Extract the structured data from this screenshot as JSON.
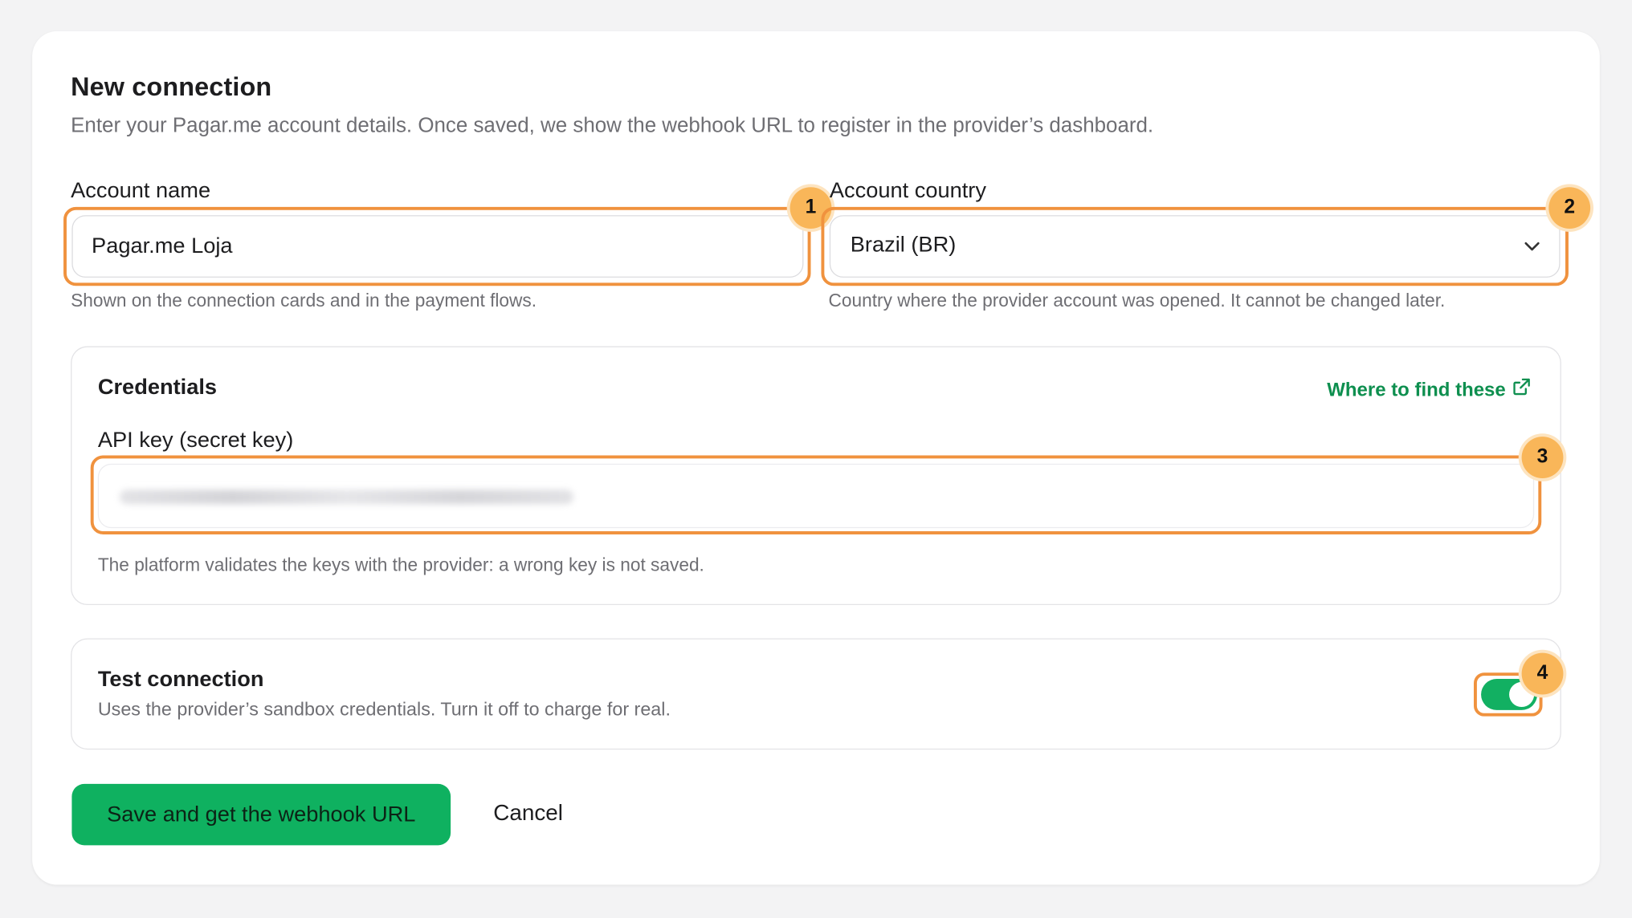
{
  "form": {
    "title": "New connection",
    "subtitle": "Enter your Pagar.me account details. Once saved, we show the webhook URL to register in the provider’s dashboard."
  },
  "account_name": {
    "label": "Account name",
    "value": "Pagar.me Loja",
    "help": "Shown on the connection cards and in the payment flows."
  },
  "account_country": {
    "label": "Account country",
    "selected": "Brazil (BR)",
    "help": "Country where the provider account was opened. It cannot be changed later."
  },
  "credentials": {
    "title": "Credentials",
    "link_label": "Where to find these",
    "api_key_label": "API key (secret key)",
    "api_key_value_redacted": true,
    "help": "The platform validates the keys with the provider: a wrong key is not saved."
  },
  "test_connection": {
    "title": "Test connection",
    "description": "Uses the provider’s sandbox credentials. Turn it off to charge for real.",
    "enabled": true
  },
  "actions": {
    "save_label": "Save and get the webhook URL",
    "cancel_label": "Cancel"
  },
  "callouts": [
    "1",
    "2",
    "3",
    "4"
  ],
  "colors": {
    "accent_green": "#0fb160",
    "link_green": "#0e8f4f",
    "highlight_orange": "#f0923e",
    "badge_orange": "#f9b659"
  }
}
